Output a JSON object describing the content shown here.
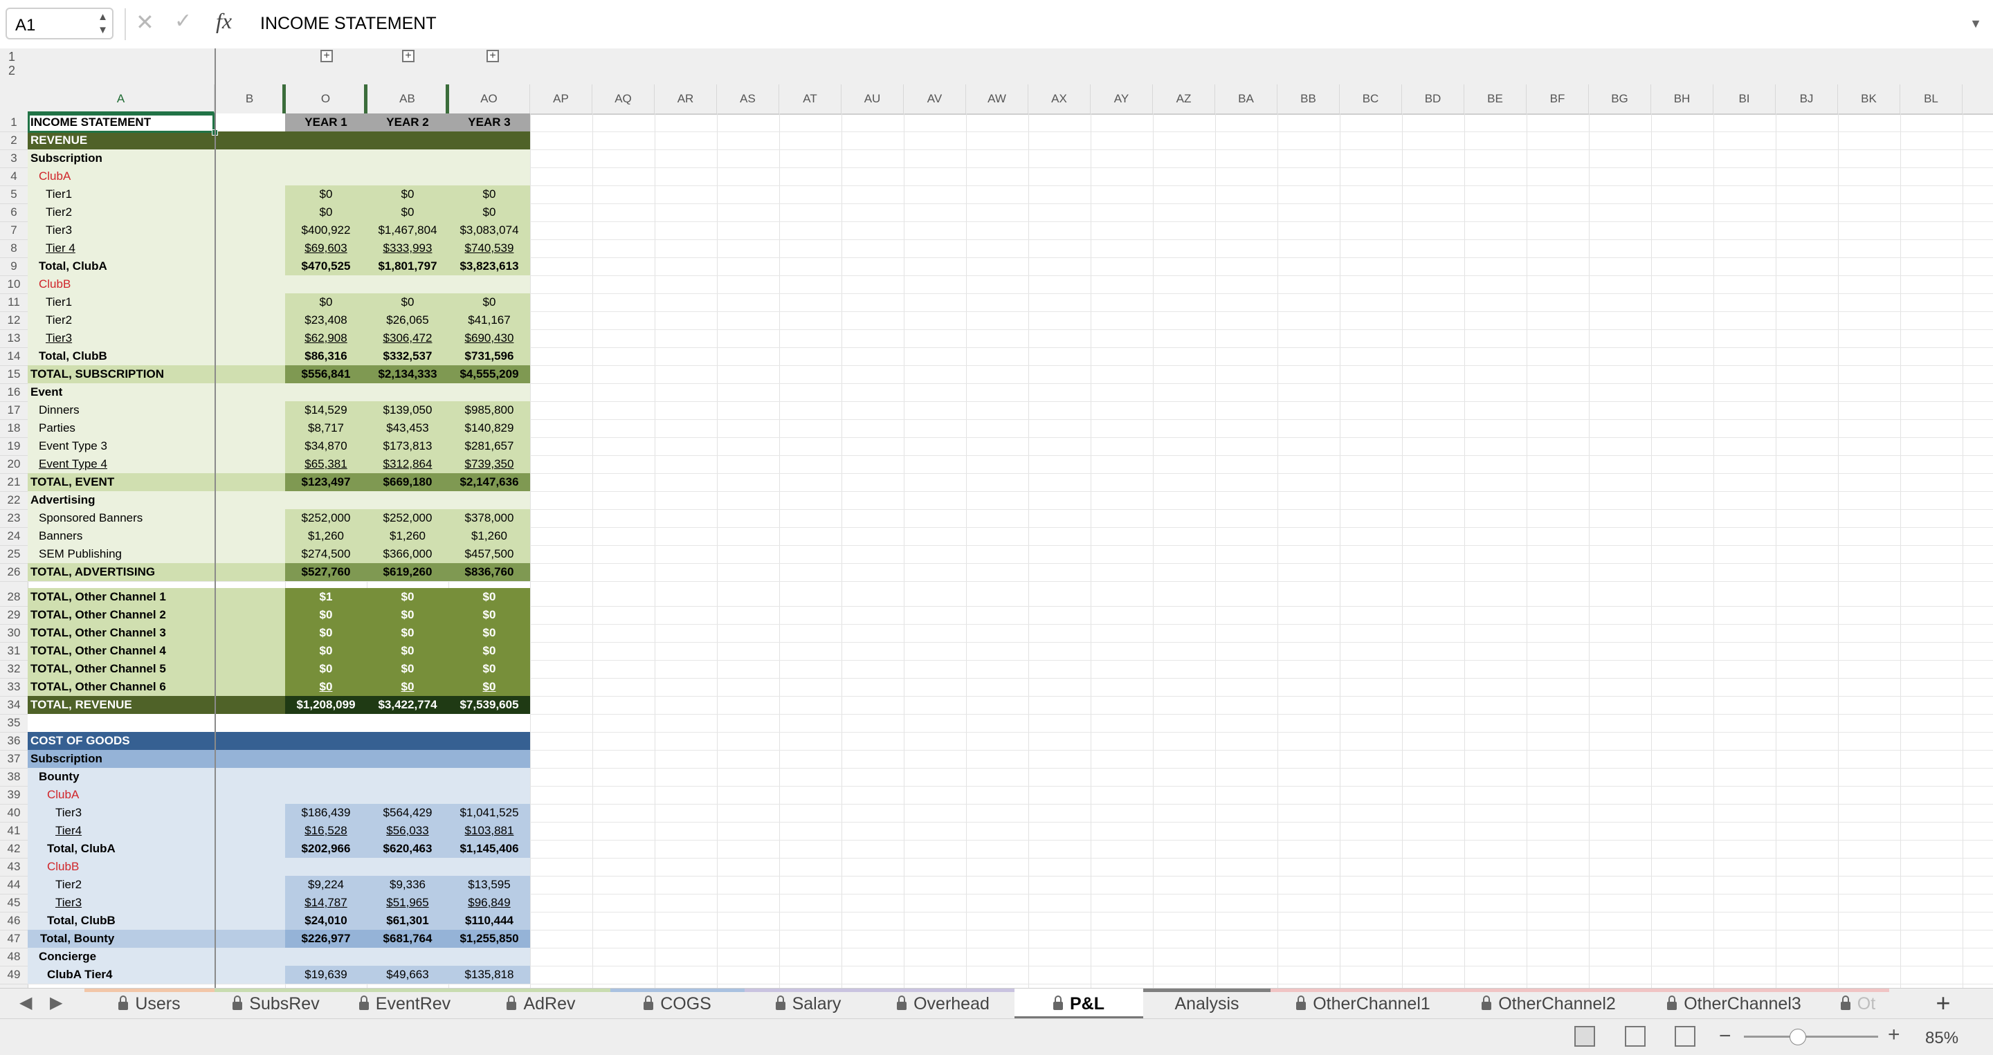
{
  "formula_bar": {
    "name_box": "A1",
    "formula": "INCOME STATEMENT"
  },
  "outline_levels": [
    "1",
    "2"
  ],
  "columns": [
    "A",
    "B",
    "O",
    "AB",
    "AO",
    "AP",
    "AQ",
    "AR",
    "AS",
    "AT",
    "AU",
    "AV",
    "AW",
    "AX",
    "AY",
    "AZ",
    "BA",
    "BB",
    "BC",
    "BD",
    "BE",
    "BF",
    "BG",
    "BH",
    "BI",
    "BJ",
    "BK",
    "BL"
  ],
  "row_numbers": [
    "1",
    "2",
    "3",
    "4",
    "5",
    "6",
    "7",
    "8",
    "9",
    "10",
    "11",
    "12",
    "13",
    "14",
    "15",
    "16",
    "17",
    "18",
    "19",
    "20",
    "21",
    "22",
    "23",
    "24",
    "25",
    "26",
    "28",
    "29",
    "30",
    "31",
    "32",
    "33",
    "34",
    "35",
    "36",
    "37",
    "38",
    "39",
    "40",
    "41",
    "42",
    "43",
    "44",
    "45",
    "46",
    "47",
    "48",
    "49"
  ],
  "rows": [
    {
      "label": "INCOME STATEMENT",
      "style": "title",
      "vals": [
        "YEAR 1",
        "YEAR 2",
        "YEAR 3"
      ]
    },
    {
      "label": "REVENUE",
      "style": "section",
      "vals": [
        "",
        "",
        ""
      ]
    },
    {
      "label": "Subscription",
      "style": "boldlabel",
      "vals": [
        "",
        "",
        ""
      ]
    },
    {
      "label": "ClubA",
      "style": "red",
      "vals": [
        "",
        "",
        ""
      ]
    },
    {
      "label": "Tier1",
      "style": "item",
      "vals": [
        "$0",
        "$0",
        "$0"
      ]
    },
    {
      "label": "Tier2",
      "style": "item",
      "vals": [
        "$0",
        "$0",
        "$0"
      ]
    },
    {
      "label": "Tier3",
      "style": "item",
      "vals": [
        "$400,922",
        "$1,467,804",
        "$3,083,074"
      ]
    },
    {
      "label": "Tier 4",
      "style": "itemu",
      "vals": [
        "$69,603",
        "$333,993",
        "$740,539"
      ]
    },
    {
      "label": "Total, ClubA",
      "style": "subtotal",
      "vals": [
        "$470,525",
        "$1,801,797",
        "$3,823,613"
      ]
    },
    {
      "label": "ClubB",
      "style": "red",
      "vals": [
        "",
        "",
        ""
      ]
    },
    {
      "label": "Tier1",
      "style": "item",
      "vals": [
        "$0",
        "$0",
        "$0"
      ]
    },
    {
      "label": "Tier2",
      "style": "item",
      "vals": [
        "$23,408",
        "$26,065",
        "$41,167"
      ]
    },
    {
      "label": "Tier3",
      "style": "itemu",
      "vals": [
        "$62,908",
        "$306,472",
        "$690,430"
      ]
    },
    {
      "label": "Total, ClubB",
      "style": "subtotal",
      "vals": [
        "$86,316",
        "$332,537",
        "$731,596"
      ]
    },
    {
      "label": "TOTAL, SUBSCRIPTION",
      "style": "total",
      "vals": [
        "$556,841",
        "$2,134,333",
        "$4,555,209"
      ]
    },
    {
      "label": "Event",
      "style": "boldlabel",
      "vals": [
        "",
        "",
        ""
      ]
    },
    {
      "label": "Dinners",
      "style": "item2",
      "vals": [
        "$14,529",
        "$139,050",
        "$985,800"
      ]
    },
    {
      "label": "Parties",
      "style": "item2",
      "vals": [
        "$8,717",
        "$43,453",
        "$140,829"
      ]
    },
    {
      "label": "Event Type 3",
      "style": "item2",
      "vals": [
        "$34,870",
        "$173,813",
        "$281,657"
      ]
    },
    {
      "label": "Event Type 4",
      "style": "item2u",
      "vals": [
        "$65,381",
        "$312,864",
        "$739,350"
      ]
    },
    {
      "label": "TOTAL, EVENT",
      "style": "total",
      "vals": [
        "$123,497",
        "$669,180",
        "$2,147,636"
      ]
    },
    {
      "label": "Advertising",
      "style": "boldlabel",
      "vals": [
        "",
        "",
        ""
      ]
    },
    {
      "label": "Sponsored Banners",
      "style": "item2",
      "vals": [
        "$252,000",
        "$252,000",
        "$378,000"
      ]
    },
    {
      "label": "Banners",
      "style": "item2",
      "vals": [
        "$1,260",
        "$1,260",
        "$1,260"
      ]
    },
    {
      "label": "SEM Publishing",
      "style": "item2",
      "vals": [
        "$274,500",
        "$366,000",
        "$457,500"
      ]
    },
    {
      "label": "TOTAL, ADVERTISING",
      "style": "total",
      "vals": [
        "$527,760",
        "$619,260",
        "$836,760"
      ]
    },
    {
      "label": "TOTAL, Other Channel 1",
      "style": "other",
      "vals": [
        "$1",
        "$0",
        "$0"
      ]
    },
    {
      "label": "TOTAL, Other Channel 2",
      "style": "other",
      "vals": [
        "$0",
        "$0",
        "$0"
      ]
    },
    {
      "label": "TOTAL, Other Channel 3",
      "style": "other",
      "vals": [
        "$0",
        "$0",
        "$0"
      ]
    },
    {
      "label": "TOTAL, Other Channel 4",
      "style": "other",
      "vals": [
        "$0",
        "$0",
        "$0"
      ]
    },
    {
      "label": "TOTAL, Other Channel 5",
      "style": "other",
      "vals": [
        "$0",
        "$0",
        "$0"
      ]
    },
    {
      "label": "TOTAL, Other Channel 6",
      "style": "otheru",
      "vals": [
        "$0",
        "$0",
        "$0"
      ]
    },
    {
      "label": "TOTAL, REVENUE",
      "style": "grand",
      "vals": [
        "$1,208,099",
        "$3,422,774",
        "$7,539,605"
      ]
    },
    {
      "label": "",
      "style": "blank",
      "vals": [
        "",
        "",
        ""
      ]
    },
    {
      "label": "COST OF GOODS",
      "style": "cogshead",
      "vals": [
        "",
        "",
        ""
      ]
    },
    {
      "label": "Subscription",
      "style": "cogssub",
      "vals": [
        "",
        "",
        ""
      ]
    },
    {
      "label": "Bounty",
      "style": "cboldlabel",
      "vals": [
        "",
        "",
        ""
      ]
    },
    {
      "label": "ClubA",
      "style": "cred",
      "vals": [
        "",
        "",
        ""
      ]
    },
    {
      "label": "Tier3",
      "style": "citem",
      "vals": [
        "$186,439",
        "$564,429",
        "$1,041,525"
      ]
    },
    {
      "label": "Tier4",
      "style": "citemu",
      "vals": [
        "$16,528",
        "$56,033",
        "$103,881"
      ]
    },
    {
      "label": "Total, ClubA",
      "style": "csubtotal",
      "vals": [
        "$202,966",
        "$620,463",
        "$1,145,406"
      ]
    },
    {
      "label": "ClubB",
      "style": "cred",
      "vals": [
        "",
        "",
        ""
      ]
    },
    {
      "label": "Tier2",
      "style": "citem",
      "vals": [
        "$9,224",
        "$9,336",
        "$13,595"
      ]
    },
    {
      "label": "Tier3",
      "style": "citemu",
      "vals": [
        "$14,787",
        "$51,965",
        "$96,849"
      ]
    },
    {
      "label": "Total, ClubB",
      "style": "csubtotal",
      "vals": [
        "$24,010",
        "$61,301",
        "$110,444"
      ]
    },
    {
      "label": "Total, Bounty",
      "style": "ctotal",
      "vals": [
        "$226,977",
        "$681,764",
        "$1,255,850"
      ]
    },
    {
      "label": "Concierge",
      "style": "cboldlabel",
      "vals": [
        "",
        "",
        ""
      ]
    },
    {
      "label": "ClubA Tier4",
      "style": "cboldlabel2",
      "vals": [
        "$19,639",
        "$49,663",
        "$135,818"
      ]
    }
  ],
  "tabs": [
    {
      "label": "Users",
      "locked": true,
      "color": "#f2c6a8"
    },
    {
      "label": "SubsRev",
      "locked": true,
      "color": "#c8dcb0"
    },
    {
      "label": "EventRev",
      "locked": true,
      "color": "#c8dcb0"
    },
    {
      "label": "AdRev",
      "locked": true,
      "color": "#c8dcb0"
    },
    {
      "label": "COGS",
      "locked": true,
      "color": "#a9c1e0"
    },
    {
      "label": "Salary",
      "locked": true,
      "color": "#c9c3e0"
    },
    {
      "label": "Overhead",
      "locked": true,
      "color": "#c9c3e0"
    },
    {
      "label": "P&L",
      "locked": true,
      "color": "#ffffff"
    },
    {
      "label": "Analysis",
      "locked": false,
      "color": "#7f7f7f"
    },
    {
      "label": "OtherChannel1",
      "locked": true,
      "color": "#f0c4c4"
    },
    {
      "label": "OtherChannel2",
      "locked": true,
      "color": "#f0c4c4"
    },
    {
      "label": "OtherChannel3",
      "locked": true,
      "color": "#f0c4c4"
    },
    {
      "label": "Ot",
      "locked": true,
      "color": "#f0c4c4"
    }
  ],
  "active_tab": "P&L",
  "zoom": "85%",
  "colors": {
    "accent": "#217346",
    "rev_light": "#ebf1de",
    "rev_val": "#d0dfb0",
    "rev_total": "#7f9952",
    "rev_dark": "#4f6228",
    "other_val": "#778f3a",
    "cogs_head": "#366092",
    "cogs_sub": "#95b3d7",
    "cogs_light": "#dce6f1",
    "cogs_val": "#b8cce4"
  }
}
